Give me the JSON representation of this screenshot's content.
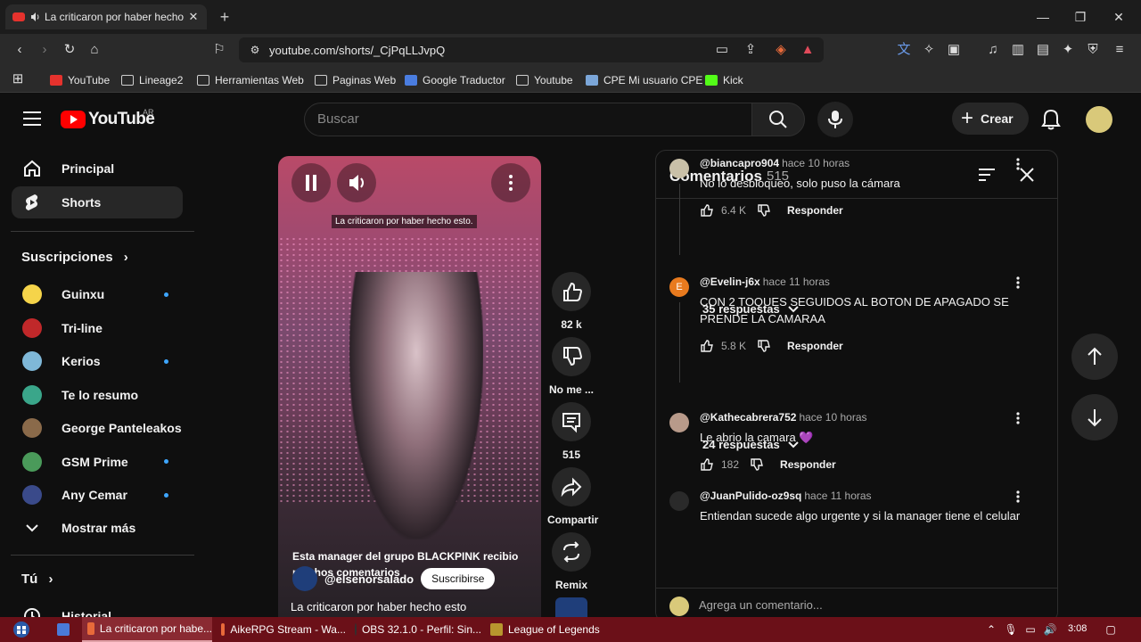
{
  "browser": {
    "tab_title": "La criticaron por haber hecho",
    "url": "youtube.com/shorts/_CjPqLLJvpQ",
    "bookmarks": [
      "YouTube",
      "Lineage2",
      "Herramientas Web",
      "Paginas Web",
      "Google Traductor",
      "Youtube",
      "CPE Mi usuario CPE",
      "Kick"
    ]
  },
  "youtube": {
    "logo_text": "YouTube",
    "country": "AR",
    "search_placeholder": "Buscar",
    "create_label": "Crear"
  },
  "sidebar": {
    "nav": [
      {
        "label": "Principal",
        "icon": "home-icon"
      },
      {
        "label": "Shorts",
        "icon": "shorts-icon",
        "active": true
      }
    ],
    "subscriptions_title": "Suscripciones",
    "subscriptions": [
      {
        "name": "Guinxu",
        "color": "#f5d44a",
        "dot": true
      },
      {
        "name": "Tri-line",
        "color": "#c0282a",
        "dot": false
      },
      {
        "name": "Kerios",
        "color": "#7fb8d8",
        "dot": true
      },
      {
        "name": "Te lo resumo",
        "color": "#3aa68a",
        "dot": false
      },
      {
        "name": "George Panteleakos",
        "color": "#8a6a4a",
        "dot": false
      },
      {
        "name": "GSM Prime",
        "color": "#4a9a5a",
        "dot": true
      },
      {
        "name": "Any Cemar",
        "color": "#3a4a8a",
        "dot": true
      }
    ],
    "show_more": "Mostrar más",
    "you_title": "Tú",
    "history": "Historial"
  },
  "short": {
    "video_caption": "La criticaron por haber hecho esto.",
    "overlay_text": "Esta manager del grupo BLACKPINK recibio muchos comentarios",
    "channel": "@elsenorsalado",
    "subscribe": "Suscribirse",
    "title": "La criticaron por haber hecho esto",
    "actions": {
      "likes": "82 k",
      "dislike": "No me ...",
      "comments": "515",
      "share": "Compartir",
      "remix": "Remix"
    }
  },
  "comments": {
    "title": "Comentarios",
    "count": "515",
    "items": [
      {
        "user": "@biancapro904",
        "time": "hace 10 horas",
        "text": "No lo desbloqueo, solo puso la cámara",
        "likes": "6.4 K",
        "reply": "Responder",
        "replies": "35 respuestas",
        "color": "#c9c0a8"
      },
      {
        "user": "@Evelin-j6x",
        "time": "hace 11 horas",
        "text": "CON 2 TOQUES SEGUIDOS AL BOTON DE APAGADO SE PRENDE LA CAMARAA",
        "likes": "5.8 K",
        "reply": "Responder",
        "replies": "24 respuestas",
        "color": "#e87a1e",
        "initial": "E"
      },
      {
        "user": "@Kathecabrera752",
        "time": "hace 10 horas",
        "text": "Le abrio la camara 💜",
        "likes": "182",
        "reply": "Responder",
        "color": "#b89a8a"
      },
      {
        "user": "@JuanPulido-oz9sq",
        "time": "hace 11 horas",
        "text": "Entiendan sucede algo urgente y si la manager tiene el celular",
        "color": "#2a2a2a"
      }
    ],
    "add_placeholder": "Agrega un comentario..."
  },
  "taskbar": {
    "tasks": [
      "La criticaron por habe...",
      "AikeRPG Stream - Wa...",
      "OBS 32.1.0 - Perfil: Sin...",
      "League of Legends"
    ],
    "time": "3:08"
  }
}
